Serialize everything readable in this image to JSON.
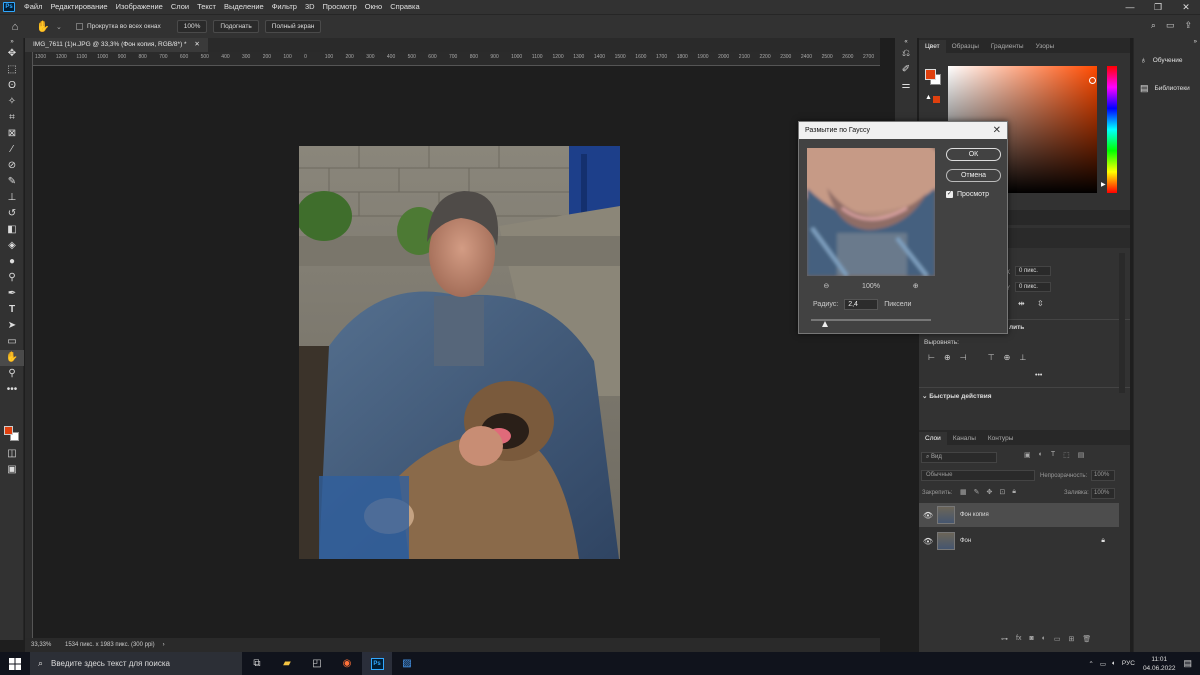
{
  "app": {
    "logo": "Ps"
  },
  "menu": [
    "Файл",
    "Редактирование",
    "Изображение",
    "Слои",
    "Текст",
    "Выделение",
    "Фильтр",
    "3D",
    "Просмотр",
    "Окно",
    "Справка"
  ],
  "window_controls": [
    "—",
    "❐",
    "✕"
  ],
  "options": {
    "scroll_all_label": "Прокрутка во всех окнах",
    "zoom_100": "100%",
    "fit": "Подогнать",
    "fullscreen": "Полный экран"
  },
  "document": {
    "tab_title": "IMG_7611 (1)н.JPG @ 33,3% (Фон копия, RGB/8*) *",
    "zoom": "33,33%",
    "size_info": "1534 пикс. x 1983 пикс. (300 ppi)"
  },
  "ruler_ticks": [
    "1300",
    "1200",
    "1100",
    "1000",
    "900",
    "800",
    "700",
    "600",
    "500",
    "400",
    "300",
    "200",
    "100",
    "0",
    "100",
    "200",
    "300",
    "400",
    "500",
    "600",
    "700",
    "800",
    "900",
    "1000",
    "1100",
    "1200",
    "1300",
    "1400",
    "1500",
    "1600",
    "1700",
    "1800",
    "1900",
    "2000",
    "2100",
    "2200",
    "2300",
    "2400",
    "2500",
    "2600",
    "2700"
  ],
  "dialog": {
    "title": "Размытие по Гауссу",
    "ok": "ОК",
    "cancel": "Отмена",
    "preview_label": "Просмотр",
    "preview_checked": true,
    "zoom": "100%",
    "radius_label": "Радиус:",
    "radius_value": "2,4",
    "radius_unit": "Пиксели"
  },
  "color_panel": {
    "tabs": [
      "Цвет",
      "Образцы",
      "Градиенты",
      "Узоры"
    ],
    "fg_color": "#e0400e",
    "bg_color": "#ffffff"
  },
  "properties": {
    "x_value": "0 пикс.",
    "y_value": "0 пикс.",
    "x_label": "X",
    "y_label": "Y",
    "align_label": "Выровнять:",
    "section_partial": "лить",
    "quick_actions": "Быстрые действия",
    "more": "•••"
  },
  "layers_panel": {
    "tabs": [
      "Слои",
      "Каналы",
      "Контуры"
    ],
    "kind_label": "Вид",
    "blend_mode": "Обычные",
    "opacity_label": "Непрозрачность:",
    "opacity_value": "100%",
    "lock_label": "Закрепить:",
    "fill_label": "Заливка:",
    "fill_value": "100%",
    "layers": [
      {
        "name": "Фон копия",
        "selected": true,
        "locked": false
      },
      {
        "name": "Фон",
        "selected": false,
        "locked": true
      }
    ]
  },
  "right_tools": [
    {
      "label": "Обучение",
      "icon": "lightbulb-icon"
    },
    {
      "label": "Библиотеки",
      "icon": "libraries-icon"
    }
  ],
  "taskbar": {
    "search_placeholder": "Введите здесь текст для поиска",
    "lang": "РУС",
    "time": "11:01",
    "date": "04.06.2022"
  }
}
